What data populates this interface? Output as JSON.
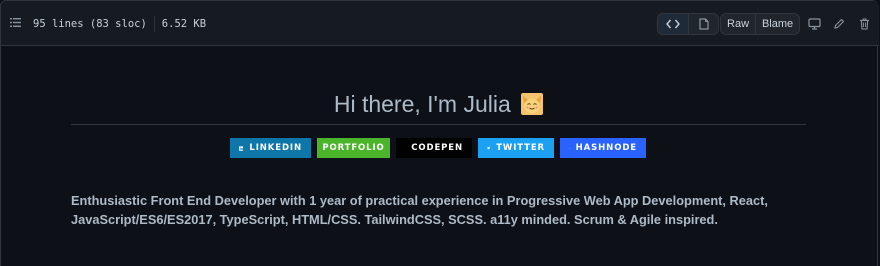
{
  "file_info": {
    "lines": "95 lines (83 sloc)",
    "size": "6.52 KB"
  },
  "toolbar": {
    "raw_label": "Raw",
    "blame_label": "Blame"
  },
  "readme": {
    "title": "Hi there, I'm Julia",
    "badges": [
      {
        "label": "LINKEDIN",
        "color": "#0e76a8"
      },
      {
        "label": "PORTFOLIO",
        "color": "#4cb42b"
      },
      {
        "label": "CODEPEN",
        "color": "#000000"
      },
      {
        "label": "TWITTER",
        "color": "#1ca0f2"
      },
      {
        "label": "HASHNODE",
        "color": "#2962ff"
      }
    ],
    "description": "Enthusiastic Front End Developer with 1 year of practical experience in Progressive Web App Development, React, JavaScript/ES6/ES2017, TypeScript, HTML/CSS. TailwindCSS, SCSS. a11y minded. Scrum & Agile inspired."
  },
  "icons": [
    "list-icon",
    "code-icon",
    "file-icon",
    "desktop-icon",
    "pencil-icon",
    "trash-icon",
    "cat-emoji-icon",
    "linkedin-icon",
    "codepen-icon",
    "twitter-icon",
    "hashnode-icon"
  ]
}
